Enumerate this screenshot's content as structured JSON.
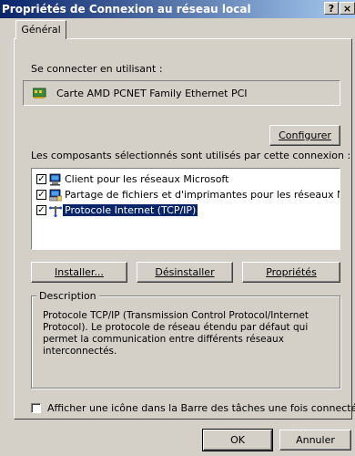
{
  "window": {
    "title": "Propriétés de Connexion au réseau local",
    "help_btn": "?",
    "close_btn": "×"
  },
  "tabs": [
    {
      "label": "Général",
      "active": true
    }
  ],
  "connect_using": {
    "label": "Se connecter en utilisant :",
    "adapter": "Carte AMD PCNET Family Ethernet PCI",
    "adapter_icon": "network-card-icon"
  },
  "configure_button": "Configurer",
  "components": {
    "label": "Les composants sélectionnés sont utilisés par cette connexion :",
    "items": [
      {
        "label": "Client pour les réseaux Microsoft",
        "checked": true,
        "icon": "client-icon",
        "selected": false
      },
      {
        "label": "Partage de fichiers et d'imprimantes pour les réseaux Micr...",
        "checked": true,
        "icon": "file-share-icon",
        "selected": false
      },
      {
        "label": "Protocole Internet (TCP/IP)",
        "checked": true,
        "icon": "protocol-icon",
        "selected": true
      }
    ]
  },
  "component_buttons": {
    "install": "Installer...",
    "uninstall": "Désinstaller",
    "properties": "Propriétés"
  },
  "description": {
    "title": "Description",
    "text": "Protocole TCP/IP (Transmission Control Protocol/Internet Protocol). Le protocole de réseau étendu par défaut qui permet la communication entre différents réseaux interconnectés."
  },
  "taskbar_option": {
    "label": "Afficher une icône dans la Barre des tâches une fois connecté",
    "checked": false
  },
  "footer": {
    "ok": "OK",
    "cancel": "Annuler"
  },
  "colors": {
    "title_start": "#0a246a",
    "title_end": "#a6caf0",
    "face": "#d4d0c8",
    "selection": "#0a246a"
  }
}
